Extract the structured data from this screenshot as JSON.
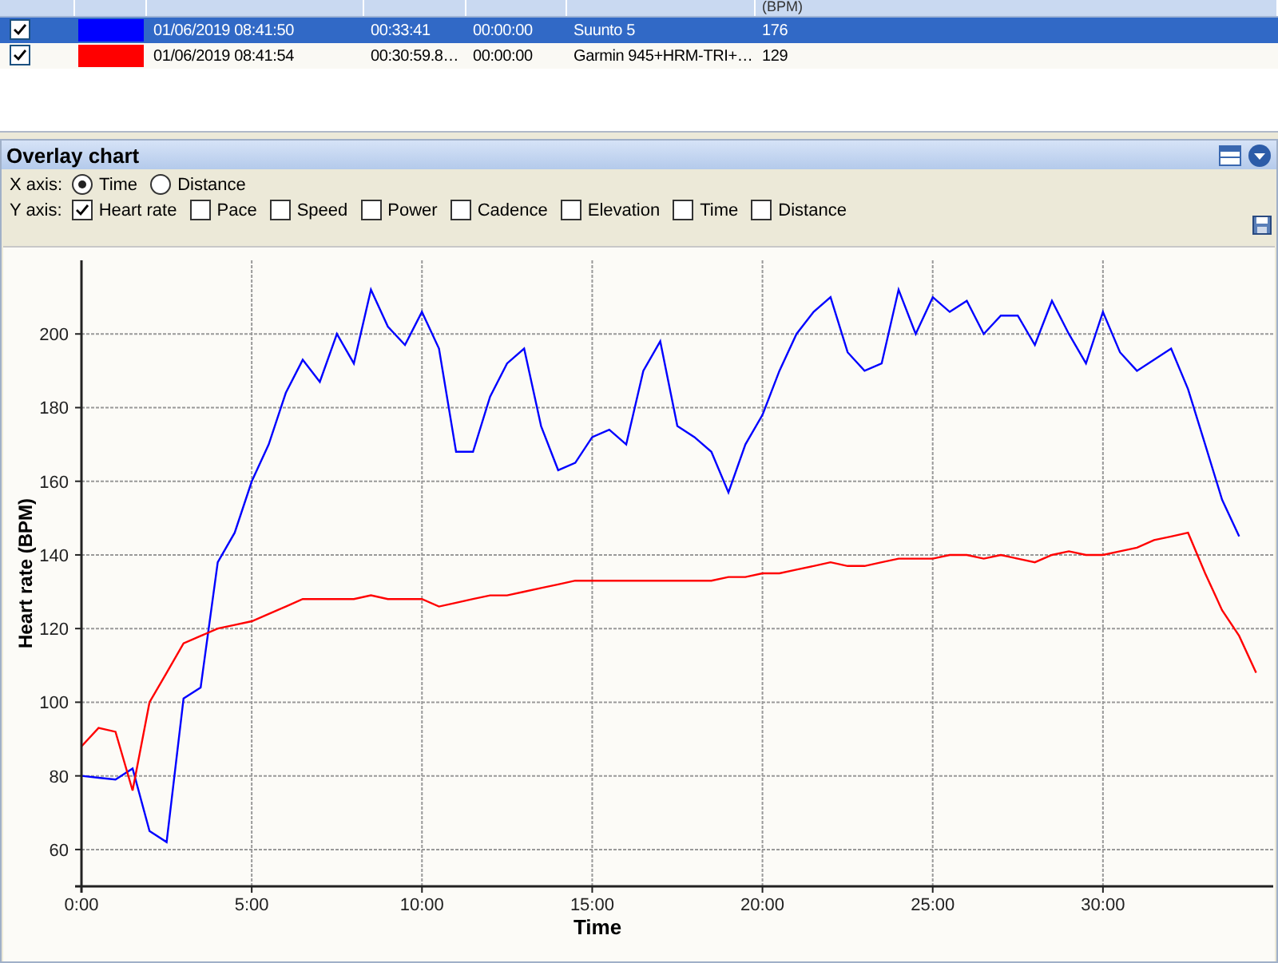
{
  "grid": {
    "columns": [
      {},
      {},
      {},
      {},
      {},
      {},
      {
        "label": "(BPM)"
      }
    ],
    "rows": [
      {
        "checked": true,
        "selected": true,
        "color": "#0000ff",
        "start": "01/06/2019 08:41:50",
        "duration": "00:33:41",
        "offset": "00:00:00",
        "device": "Suunto 5",
        "value": "176"
      },
      {
        "checked": true,
        "selected": false,
        "color": "#ff0000",
        "start": "01/06/2019 08:41:54",
        "duration": "00:30:59.8…",
        "offset": "00:00:00",
        "device": "Garmin  945+HRM-TRI+…",
        "value": "129"
      }
    ]
  },
  "panel": {
    "title": "Overlay chart",
    "x_axis": {
      "label": "X axis:",
      "options": [
        {
          "label": "Time",
          "selected": true
        },
        {
          "label": "Distance",
          "selected": false
        }
      ]
    },
    "y_axis": {
      "label": "Y axis:",
      "options": [
        {
          "label": "Heart rate",
          "checked": true
        },
        {
          "label": "Pace",
          "checked": false
        },
        {
          "label": "Speed",
          "checked": false
        },
        {
          "label": "Power",
          "checked": false
        },
        {
          "label": "Cadence",
          "checked": false
        },
        {
          "label": "Elevation",
          "checked": false
        },
        {
          "label": "Time",
          "checked": false
        },
        {
          "label": "Distance",
          "checked": false
        }
      ]
    },
    "chart_data": {
      "type": "line",
      "grid": true,
      "xlabel": "Time",
      "ylabel": "Heart rate (BPM)",
      "xlim": [
        0,
        35
      ],
      "ylim": [
        50,
        220
      ],
      "xticks": [
        {
          "value": 0,
          "label": "0:00"
        },
        {
          "value": 5,
          "label": "5:00"
        },
        {
          "value": 10,
          "label": "10:00"
        },
        {
          "value": 15,
          "label": "15:00"
        },
        {
          "value": 20,
          "label": "20:00"
        },
        {
          "value": 25,
          "label": "25:00"
        },
        {
          "value": 30,
          "label": "30:00"
        }
      ],
      "yticks": [
        60,
        80,
        100,
        120,
        140,
        160,
        180,
        200
      ],
      "x": [
        0,
        0.5,
        1,
        1.5,
        2,
        2.5,
        3,
        3.5,
        4,
        4.5,
        5,
        5.5,
        6,
        6.5,
        7,
        7.5,
        8,
        8.5,
        9,
        9.5,
        10,
        10.5,
        11,
        11.5,
        12,
        12.5,
        13,
        13.5,
        14,
        14.5,
        15,
        15.5,
        16,
        16.5,
        17,
        17.5,
        18,
        18.5,
        19,
        19.5,
        20,
        20.5,
        21,
        21.5,
        22,
        22.5,
        23,
        23.5,
        24,
        24.5,
        25,
        25.5,
        26,
        26.5,
        27,
        27.5,
        28,
        28.5,
        29,
        29.5,
        30,
        30.5,
        31,
        31.5,
        32,
        32.5,
        33,
        33.5,
        34,
        34.5
      ],
      "series": [
        {
          "color": "#0000ff",
          "values": [
            80,
            79.5,
            79,
            82,
            65,
            62,
            101,
            104,
            138,
            146,
            160,
            170,
            184,
            193,
            187,
            200,
            192,
            212,
            202,
            197,
            206,
            196,
            168,
            168,
            183,
            192,
            196,
            175,
            163,
            165,
            172,
            174,
            170,
            190,
            198,
            175,
            172,
            168,
            157,
            170,
            178,
            190,
            200,
            206,
            210,
            195,
            190,
            192,
            212,
            200,
            210,
            206,
            209,
            200,
            205,
            205,
            197,
            209,
            200,
            192,
            206,
            195,
            190,
            193,
            196,
            185,
            170,
            155,
            145,
            null
          ]
        },
        {
          "color": "#ff0000",
          "values": [
            88,
            93,
            92,
            76,
            100,
            108,
            116,
            118,
            120,
            121,
            122,
            124,
            126,
            128,
            128,
            128,
            128,
            129,
            128,
            128,
            128,
            126,
            127,
            128,
            129,
            129,
            130,
            131,
            132,
            133,
            133,
            133,
            133,
            133,
            133,
            133,
            133,
            133,
            134,
            134,
            135,
            135,
            136,
            137,
            138,
            137,
            137,
            138,
            139,
            139,
            139,
            140,
            140,
            139,
            140,
            139,
            138,
            140,
            141,
            140,
            140,
            141,
            142,
            144,
            145,
            146,
            135,
            125,
            118,
            108
          ]
        }
      ]
    }
  }
}
